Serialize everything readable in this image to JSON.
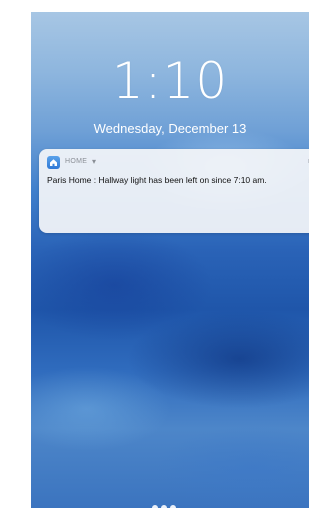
{
  "lockscreen": {
    "time": "1:10",
    "date": "Wednesday, December 13"
  },
  "notification": {
    "app_name": "HOME",
    "chevron": "▾",
    "timestamp": "now",
    "message": "Paris Home : Hallway light has been left on since 7:10 am."
  },
  "icons": {
    "app_icon": "home-app-icon"
  }
}
